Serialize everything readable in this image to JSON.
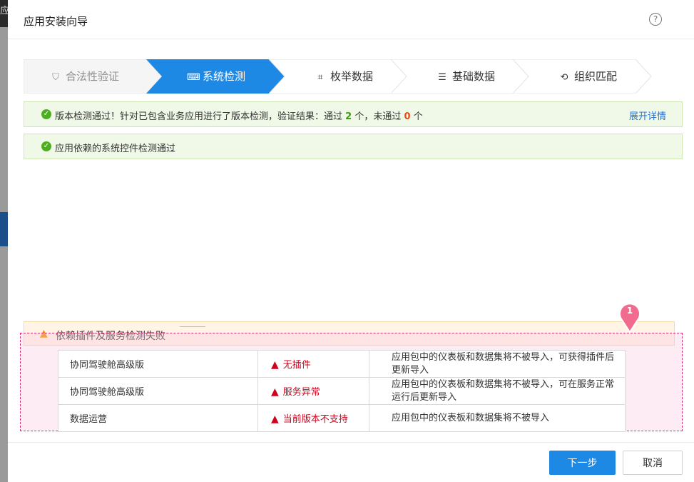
{
  "background": {
    "left_strip_char": "应"
  },
  "dialog": {
    "title": "应用安装向导",
    "help_icon": "question-circle-icon"
  },
  "steps": [
    {
      "label": "合法性验证",
      "icon": "shield-check-icon",
      "state": "done"
    },
    {
      "label": "系统检测",
      "icon": "monitor-check-icon",
      "state": "active"
    },
    {
      "label": "枚举数据",
      "icon": "scan-icon",
      "state": "todo"
    },
    {
      "label": "基础数据",
      "icon": "list-doc-icon",
      "state": "todo"
    },
    {
      "label": "组织匹配",
      "icon": "org-sync-icon",
      "state": "todo"
    }
  ],
  "version_alert": {
    "prefix": "版本检测通过！针对已包含业务应用进行了版本检测，验证结果：通过",
    "pass_count": "2",
    "mid": "个，未通过",
    "fail_count": "0",
    "suffix": "个",
    "link": "展开详情"
  },
  "controls_alert": {
    "text": "应用依赖的系统控件检测通过"
  },
  "failure": {
    "title": "依赖插件及服务检测失败",
    "marker": "1",
    "rows": [
      {
        "app": "协同驾驶舱高级版",
        "status": "无插件",
        "desc": "应用包中的仪表板和数据集将不被导入，可获得插件后更新导入"
      },
      {
        "app": "协同驾驶舱高级版",
        "status": "服务异常",
        "desc": "应用包中的仪表板和数据集将不被导入，可在服务正常运行后更新导入"
      },
      {
        "app": "数据运营",
        "status": "当前版本不支持",
        "desc": "应用包中的仪表板和数据集将不被导入"
      }
    ]
  },
  "footer": {
    "next": "下一步",
    "cancel": "取消"
  },
  "colors": {
    "primary": "#1e88e5",
    "success": "#4caf20",
    "error": "#d0021b",
    "warning": "#f08c00",
    "highlight": "#e0327c"
  }
}
